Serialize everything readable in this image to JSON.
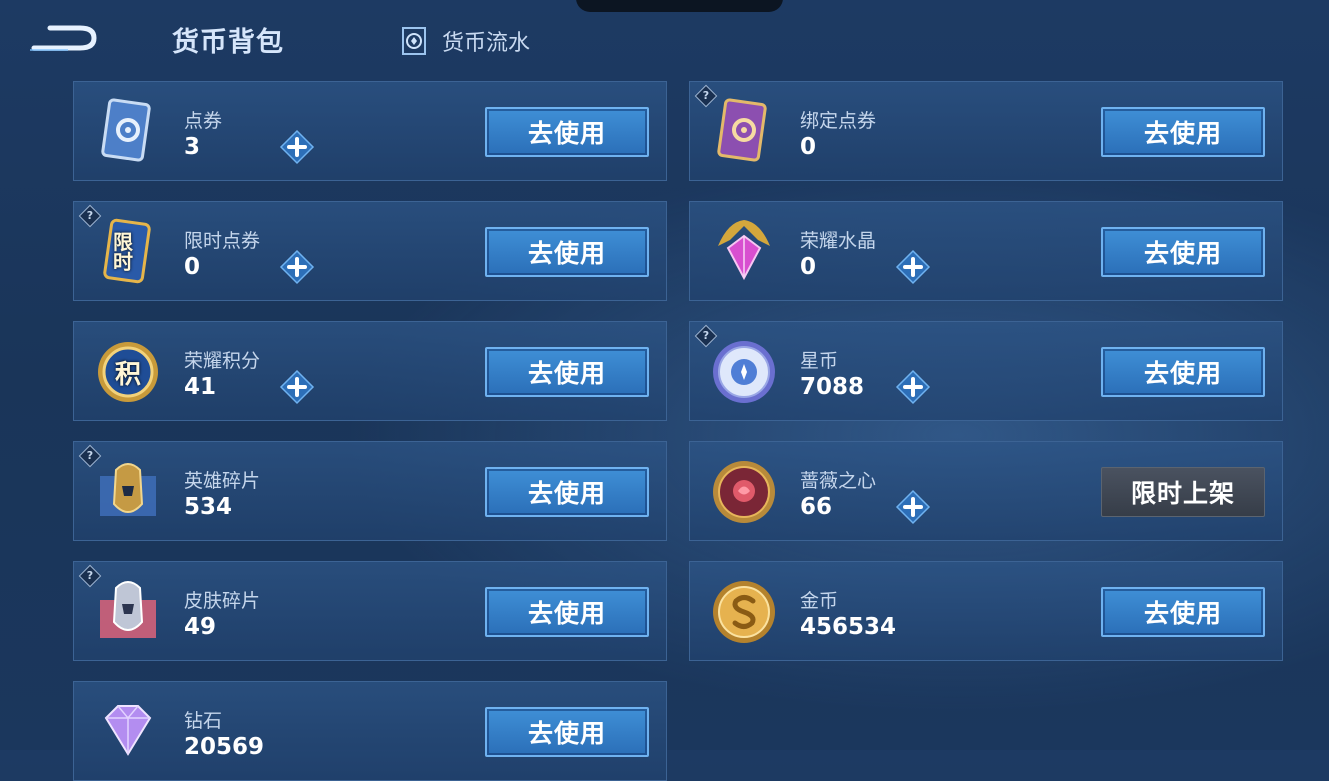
{
  "header": {
    "title": "货币背包",
    "flow_label": "货币流水"
  },
  "colors": {
    "button_blue": "#3f8fd6",
    "button_gray": "#4a5260",
    "panel_border": "#3c6394"
  },
  "currencies": [
    {
      "name": "点券",
      "value": "3",
      "action": "去使用",
      "icon": "coupon-card-icon",
      "has_plus": true,
      "has_help": false
    },
    {
      "name": "绑定点券",
      "value": "0",
      "action": "去使用",
      "icon": "bound-coupon-card-icon",
      "has_plus": false,
      "has_help": true
    },
    {
      "name": "限时点券",
      "value": "0",
      "action": "去使用",
      "icon": "limited-coupon-icon",
      "icon_text": "限时",
      "has_plus": true,
      "has_help": true
    },
    {
      "name": "荣耀水晶",
      "value": "0",
      "action": "去使用",
      "icon": "glory-crystal-icon",
      "has_plus": true,
      "has_help": false
    },
    {
      "name": "荣耀积分",
      "value": "41",
      "action": "去使用",
      "icon": "glory-points-icon",
      "icon_text": "积",
      "has_plus": true,
      "has_help": false
    },
    {
      "name": "星币",
      "value": "7088",
      "action": "去使用",
      "icon": "star-coin-icon",
      "has_plus": true,
      "has_help": true
    },
    {
      "name": "英雄碎片",
      "value": "534",
      "action": "去使用",
      "icon": "hero-fragment-icon",
      "has_plus": false,
      "has_help": true
    },
    {
      "name": "蔷薇之心",
      "value": "66",
      "action": "限时上架",
      "icon": "rose-heart-icon",
      "has_plus": true,
      "has_help": false
    },
    {
      "name": "皮肤碎片",
      "value": "49",
      "action": "去使用",
      "icon": "skin-fragment-icon",
      "has_plus": false,
      "has_help": true
    },
    {
      "name": "金币",
      "value": "456534",
      "action": "去使用",
      "icon": "gold-coin-icon",
      "has_plus": false,
      "has_help": false
    },
    {
      "name": "钻石",
      "value": "20569",
      "action": "去使用",
      "icon": "diamond-icon",
      "has_plus": false,
      "has_help": false
    }
  ]
}
